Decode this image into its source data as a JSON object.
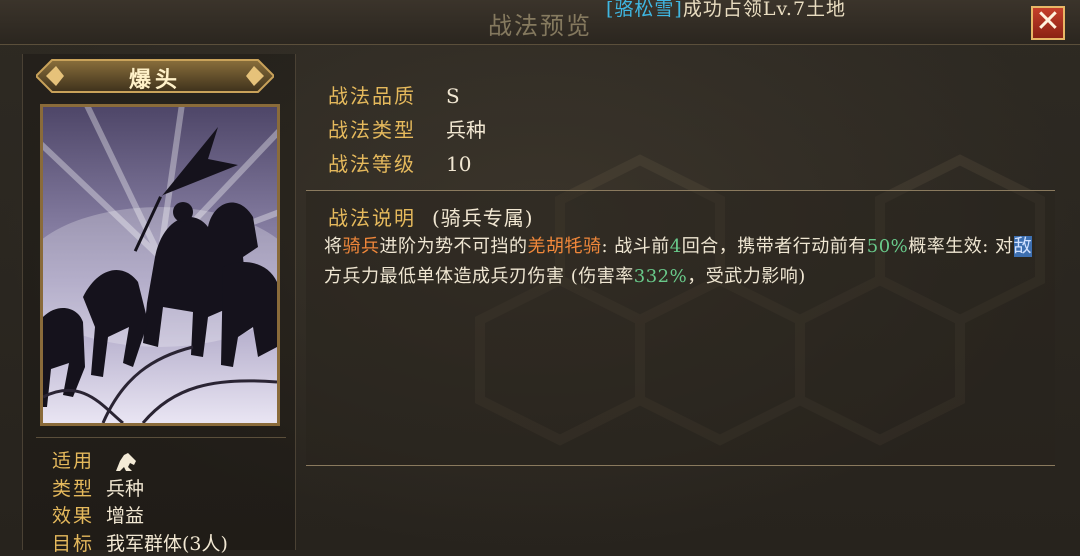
{
  "window": {
    "title": "战法预览"
  },
  "marquee": {
    "name": "[骆松雪]",
    "rest": "成功占领Lv.7土地"
  },
  "close_button": {
    "label": "✕"
  },
  "tactic": {
    "name": "爆头",
    "quality_label": "战法品质",
    "quality": "S",
    "type_label": "战法类型",
    "type": "兵种",
    "level_label": "战法等级",
    "level": "10"
  },
  "attributes": {
    "applicable_label": "适用",
    "applicable_icon": "cavalry-icon",
    "category_label": "类型",
    "category": "兵种",
    "effect_label": "效果",
    "effect": "增益",
    "target_label": "目标",
    "target": "我军群体(3人)"
  },
  "description": {
    "title": "战法说明",
    "subtitle": "(骑兵专属)",
    "p1": "将",
    "p2": "骑兵",
    "p3": "进阶为势不可挡的",
    "p4": "羌胡牦骑",
    "p5": ": 战斗前",
    "p6": "4",
    "p7": "回合，携带者行动前有",
    "p8": "50%",
    "p9": "概率生效: 对",
    "p10": "敌",
    "p11": "方兵力最低单体造成兵刃伤害 (伤害率",
    "p12": "332%",
    "p13": "，受武力影响)"
  },
  "colors": {
    "accent_gold": "#e5b95c",
    "highlight_orange": "#f0873a",
    "highlight_green": "#69c98a",
    "close_red": "#b83a25"
  }
}
